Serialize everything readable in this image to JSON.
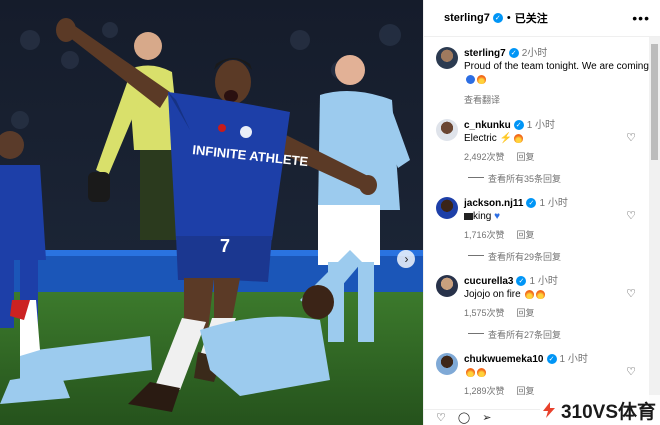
{
  "post": {
    "username": "sterling7",
    "follow_label": "已关注",
    "more_icon": "more-horizontal-icon"
  },
  "caption": {
    "username": "sterling7",
    "time": "2小时",
    "text": "Proud of the team tonight. We are coming",
    "translate_label": "查看翻译"
  },
  "comments": [
    {
      "username": "c_nkunku",
      "time": "1 小时",
      "text": "Electric",
      "likes": "2,492次赞",
      "reply": "回复",
      "view_more": "查看所有35条回复"
    },
    {
      "username": "jackson.nj11",
      "time": "1 小时",
      "text": "king",
      "likes": "1,716次赞",
      "reply": "回复",
      "view_more": "查看所有29条回复"
    },
    {
      "username": "cucurella3",
      "time": "1 小时",
      "text": "Jojojo on fire",
      "likes": "1,575次赞",
      "reply": "回复",
      "view_more": "查看所有27条回复"
    },
    {
      "username": "chukwuemeka10",
      "time": "1 小时",
      "text": "",
      "likes": "1,289次赞",
      "reply": "回复",
      "view_more": ""
    }
  ],
  "photo": {
    "sponsor_text": "INFINITE ATHLETE",
    "shirt_number": "7"
  },
  "watermark": {
    "text": "310VS体育"
  },
  "colors": {
    "verified": "#0095f6",
    "chelsea_blue": "#1d3fa8",
    "city_blue": "#8ec3ea",
    "pitch": "#2f6b26"
  }
}
